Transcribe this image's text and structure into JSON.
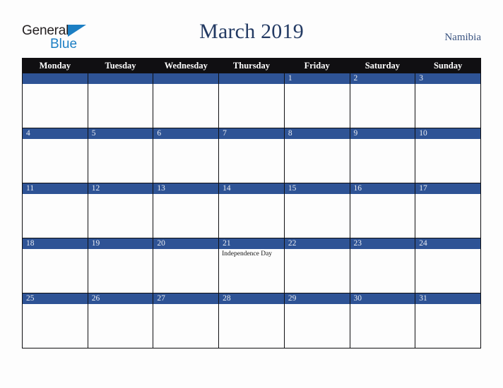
{
  "logo": {
    "text_primary": "General",
    "text_secondary": "Blue",
    "triangle_color": "#1c7fc4",
    "primary_color": "#231f20"
  },
  "header": {
    "title": "March 2019",
    "region": "Namibia",
    "title_color": "#233a63",
    "region_color": "#3a5380"
  },
  "colors": {
    "header_row_bg": "#100f12",
    "day_bar_bg": "#2e5395",
    "day_number_text": "#e9ecf3",
    "page_bg": "#fdfdfd",
    "grid_line": "#0f0f11"
  },
  "calendar": {
    "weekday_headers": [
      "Monday",
      "Tuesday",
      "Wednesday",
      "Thursday",
      "Friday",
      "Saturday",
      "Sunday"
    ],
    "weeks": [
      [
        {
          "day": "",
          "events": []
        },
        {
          "day": "",
          "events": []
        },
        {
          "day": "",
          "events": []
        },
        {
          "day": "",
          "events": []
        },
        {
          "day": "1",
          "events": []
        },
        {
          "day": "2",
          "events": []
        },
        {
          "day": "3",
          "events": []
        }
      ],
      [
        {
          "day": "4",
          "events": []
        },
        {
          "day": "5",
          "events": []
        },
        {
          "day": "6",
          "events": []
        },
        {
          "day": "7",
          "events": []
        },
        {
          "day": "8",
          "events": []
        },
        {
          "day": "9",
          "events": []
        },
        {
          "day": "10",
          "events": []
        }
      ],
      [
        {
          "day": "11",
          "events": []
        },
        {
          "day": "12",
          "events": []
        },
        {
          "day": "13",
          "events": []
        },
        {
          "day": "14",
          "events": []
        },
        {
          "day": "15",
          "events": []
        },
        {
          "day": "16",
          "events": []
        },
        {
          "day": "17",
          "events": []
        }
      ],
      [
        {
          "day": "18",
          "events": []
        },
        {
          "day": "19",
          "events": []
        },
        {
          "day": "20",
          "events": []
        },
        {
          "day": "21",
          "events": [
            "Independence Day"
          ]
        },
        {
          "day": "22",
          "events": []
        },
        {
          "day": "23",
          "events": []
        },
        {
          "day": "24",
          "events": []
        }
      ],
      [
        {
          "day": "25",
          "events": []
        },
        {
          "day": "26",
          "events": []
        },
        {
          "day": "27",
          "events": []
        },
        {
          "day": "28",
          "events": []
        },
        {
          "day": "29",
          "events": []
        },
        {
          "day": "30",
          "events": []
        },
        {
          "day": "31",
          "events": []
        }
      ]
    ]
  }
}
